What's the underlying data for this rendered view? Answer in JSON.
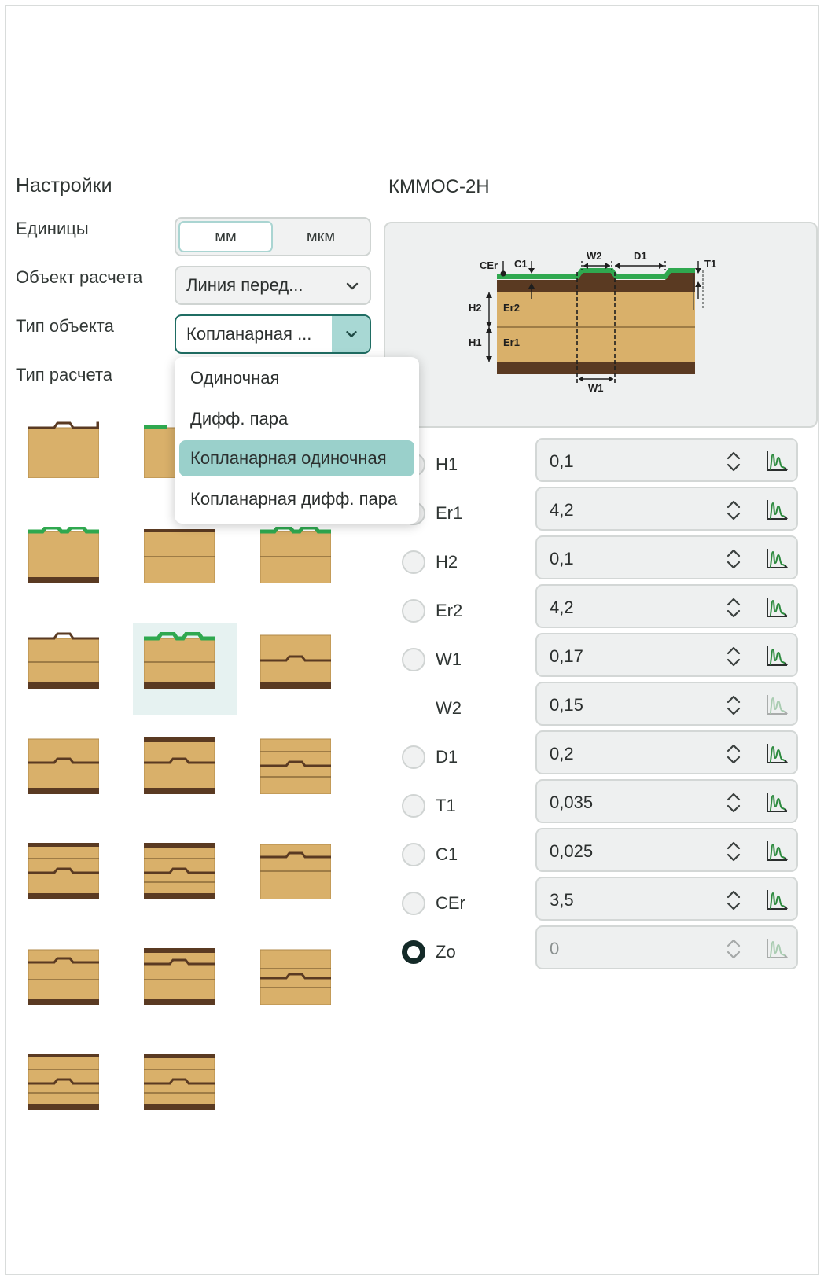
{
  "settings": {
    "title": "Настройки",
    "units_label": "Единицы",
    "units_options": [
      "мм",
      "мкм"
    ],
    "calc_object_label": "Объект расчета",
    "calc_object_value": "Линия перед...",
    "object_type_label": "Тип объекта",
    "object_type_value": "Копланарная ...",
    "calc_type_label": "Тип расчета"
  },
  "dropdown": {
    "items": [
      "Одиночная",
      "Дифф. пара",
      "Копланарная одиночная",
      "Копланарная дифф. пара"
    ],
    "selected": "Копланарная одиночная"
  },
  "model": {
    "title": "КММОС-2Н",
    "diagram_labels": {
      "cer": "CEr",
      "c1": "C1",
      "w2": "W2",
      "d1": "D1",
      "t1": "T1",
      "h2": "H2",
      "er2": "Er2",
      "h1": "H1",
      "er1": "Er1",
      "w1": "W1"
    }
  },
  "params": [
    {
      "name": "H1",
      "value": "0,1",
      "radio": true,
      "checked": false,
      "disabled": false
    },
    {
      "name": "Er1",
      "value": "4,2",
      "radio": true,
      "checked": false,
      "disabled": false
    },
    {
      "name": "H2",
      "value": "0,1",
      "radio": true,
      "checked": false,
      "disabled": false
    },
    {
      "name": "Er2",
      "value": "4,2",
      "radio": true,
      "checked": false,
      "disabled": false
    },
    {
      "name": "W1",
      "value": "0,17",
      "radio": true,
      "checked": false,
      "disabled": false
    },
    {
      "name": "W2",
      "value": "0,15",
      "radio": false,
      "checked": false,
      "disabled": false,
      "graph_disabled": true
    },
    {
      "name": "D1",
      "value": "0,2",
      "radio": true,
      "checked": false,
      "disabled": false
    },
    {
      "name": "T1",
      "value": "0,035",
      "radio": true,
      "checked": false,
      "disabled": false
    },
    {
      "name": "C1",
      "value": "0,025",
      "radio": true,
      "checked": false,
      "disabled": false
    },
    {
      "name": "CEr",
      "value": "3,5",
      "radio": true,
      "checked": false,
      "disabled": false
    },
    {
      "name": "Zo",
      "value": "0",
      "radio": true,
      "checked": true,
      "disabled": true
    }
  ],
  "icons": {
    "chevron": "chevron-down-icon",
    "stepper": "up-down-stepper-icon",
    "graph": "graph-icon"
  },
  "colors": {
    "accent": "#1f6d63",
    "selected_item": "#9ad0cb",
    "substrate": "#d9b06a",
    "copper": "#5a3a22",
    "solder_mask": "#2fa84f",
    "graph_icon": "#2c8a3e"
  }
}
